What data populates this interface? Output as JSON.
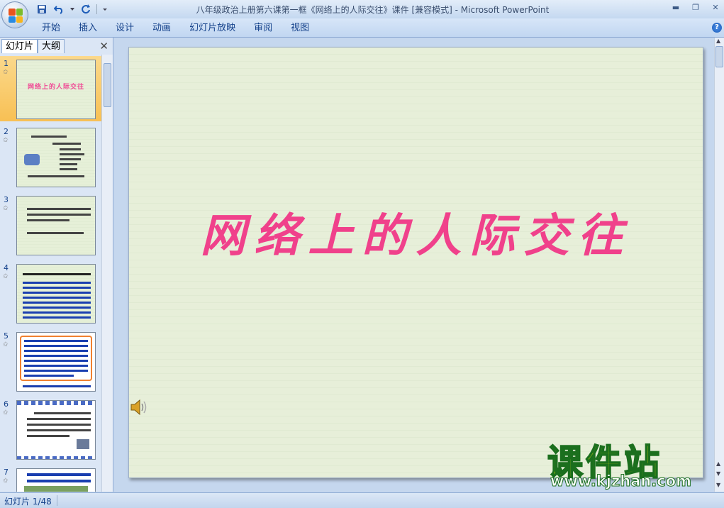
{
  "window": {
    "title": "八年级政治上册第六课第一框《网络上的人际交往》课件 [兼容模式] - Microsoft PowerPoint"
  },
  "ribbon": {
    "tabs": [
      "开始",
      "插入",
      "设计",
      "动画",
      "幻灯片放映",
      "审阅",
      "视图"
    ]
  },
  "panel": {
    "tabs": [
      "幻灯片",
      "大纲"
    ],
    "close": "✕"
  },
  "slides": [
    {
      "num": "1",
      "title": "网络上的人际交往",
      "selected": true
    },
    {
      "num": "2"
    },
    {
      "num": "3"
    },
    {
      "num": "4"
    },
    {
      "num": "5"
    },
    {
      "num": "6"
    },
    {
      "num": "7"
    }
  ],
  "current_slide": {
    "title": "网络上的人际交往"
  },
  "status": {
    "slide_info": "幻灯片 1/48"
  },
  "watermark": {
    "brand": "课件站",
    "url": "www.kjzhan.com"
  },
  "colors": {
    "title_pink": "#f0418b",
    "slide_bg": "#e7efd9"
  }
}
